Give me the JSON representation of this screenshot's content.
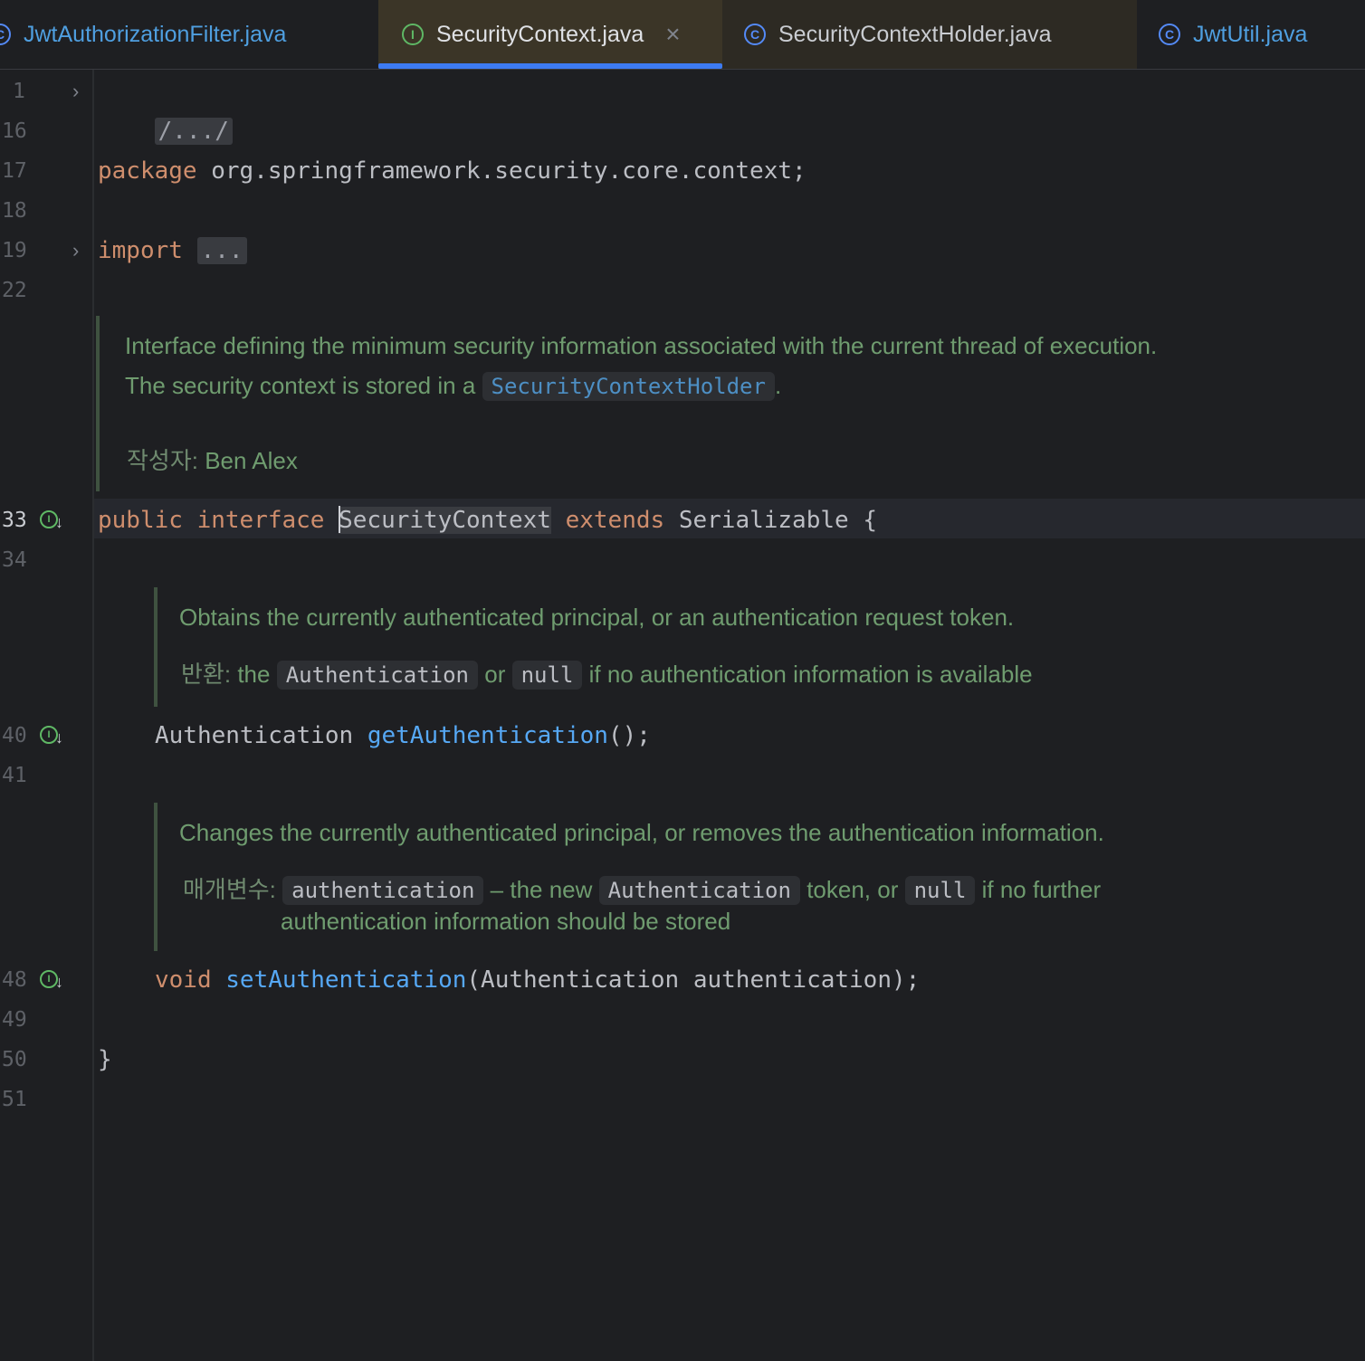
{
  "tabs": [
    {
      "label": "JwtAuthorizationFilter.java",
      "icon": "class-icon",
      "state": "inactive"
    },
    {
      "label": "SecurityContext.java",
      "icon": "interface-icon",
      "state": "active",
      "close": "×"
    },
    {
      "label": "SecurityContextHolder.java",
      "icon": "class-icon",
      "state": "inactive"
    },
    {
      "label": "JwtUtil.java",
      "icon": "class-icon",
      "state": "inactive"
    }
  ],
  "tab_icon_glyphs": {
    "class": "C",
    "interface": "I"
  },
  "line_numbers": {
    "l1": "1",
    "l16": "16",
    "l17": "17",
    "l18": "18",
    "l19": "19",
    "l22": "22",
    "l33": "33",
    "l34": "34",
    "l40": "40",
    "l41": "41",
    "l48": "48",
    "l49": "49",
    "l50": "50",
    "l51": "51"
  },
  "code": {
    "header_fold": "/.../",
    "package_kw": "package",
    "package_name": " org.springframework.security.core.context;",
    "import_kw": "import",
    "import_fold": "...",
    "public_kw": "public",
    "interface_kw": "interface",
    "type_name": "SecurityContext",
    "extends_kw": "extends",
    "super_type": "Serializable {",
    "get_return_type": "Authentication ",
    "get_method": "getAuthentication",
    "get_tail": "();",
    "void_kw": "void",
    "set_method": "setAuthentication",
    "set_tail": "(Authentication authentication);",
    "closing_brace": "}"
  },
  "docs": {
    "class_doc": {
      "line1": "Interface defining the minimum security information associated with the current thread of execution.",
      "line2_prefix": "The security context is stored in a ",
      "line2_link": "SecurityContextHolder",
      "line2_suffix": ".",
      "author_tag": "작성자:",
      "author": "Ben Alex"
    },
    "get_doc": {
      "line1": "Obtains the currently authenticated principal, or an authentication request token.",
      "return_tag": "반환:",
      "ret_the": "the",
      "ret_code1": "Authentication",
      "ret_or": "or",
      "ret_code2": "null",
      "ret_tail": "if no authentication information is available"
    },
    "set_doc": {
      "line1": "Changes the currently authenticated principal, or removes the authentication information.",
      "param_tag": "매개변수:",
      "param_name": "authentication",
      "param_mid": "– the new",
      "param_code": "Authentication",
      "param_or": "token, or",
      "param_null": "null",
      "param_tail": "if no further",
      "param_line2": "authentication information should be stored"
    }
  },
  "colors": {
    "background": "#1e1f22",
    "keyword": "#cf8e6d",
    "method": "#56a8f5",
    "doc_text": "#6f9c6f",
    "accent_tab_underline": "#3d7bf2"
  }
}
